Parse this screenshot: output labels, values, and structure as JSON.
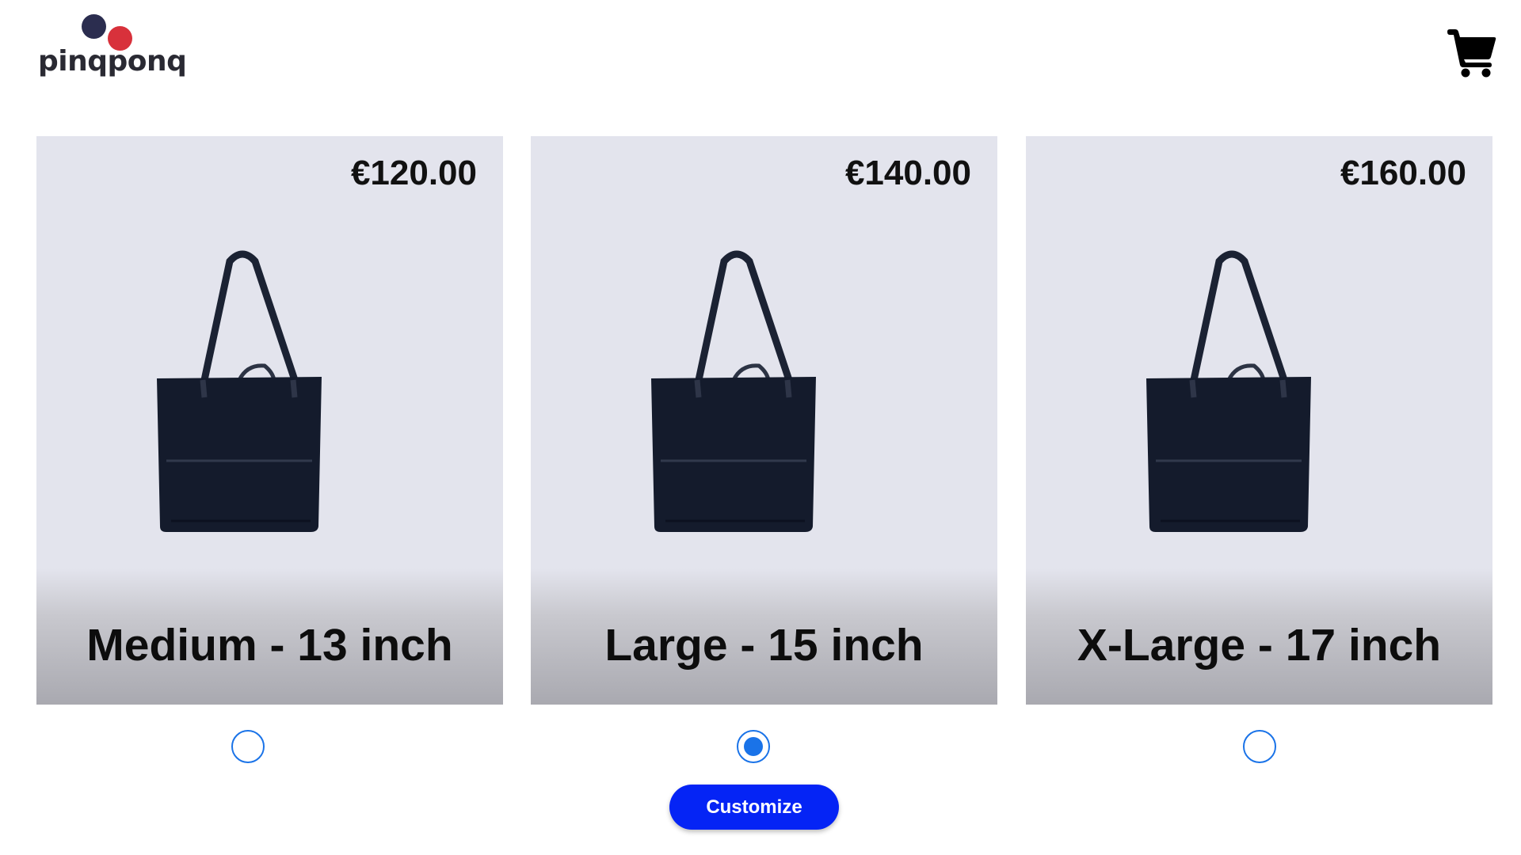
{
  "header": {
    "logo_text": "pinqponq",
    "logo_dot_colors": [
      "#2b2d4f",
      "#d8313b"
    ],
    "cart_icon": "shopping-cart-icon"
  },
  "products": [
    {
      "price": "€120.00",
      "size_label": "Medium - 13 inch",
      "selected": false
    },
    {
      "price": "€140.00",
      "size_label": "Large - 15 inch",
      "selected": true
    },
    {
      "price": "€160.00",
      "size_label": "X-Large - 17 inch",
      "selected": false
    }
  ],
  "actions": {
    "customize_label": "Customize"
  },
  "colors": {
    "card_background": "#e3e4ed",
    "radio_accent": "#1a73e8",
    "button_background": "#0524f5",
    "button_text": "#ffffff"
  }
}
